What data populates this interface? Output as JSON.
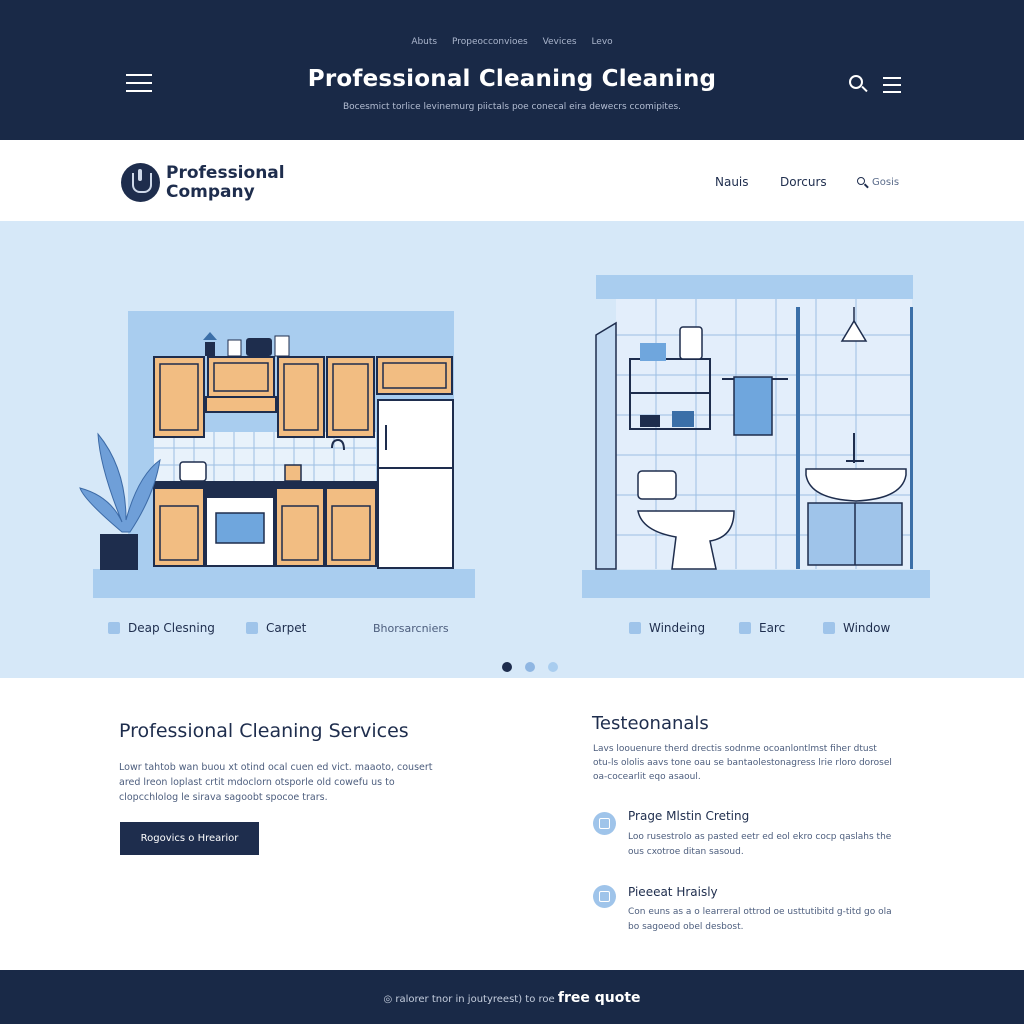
{
  "header": {
    "links": [
      "Abuts",
      "Propeocconvioes",
      "Vevices",
      "Levo"
    ],
    "title": "Professional Cleaning Cleaning",
    "subtitle": "Bocesmict torlice levinemurg piictals poe conecal eira dewecrs ccomipites.",
    "menu_icon": "hamburger-icon",
    "search_icon": "search-icon"
  },
  "nav": {
    "logo_line1": "Professional",
    "logo_line2": "Company",
    "links": [
      "Nauis",
      "Dorcurs"
    ],
    "search_label": "Gosis"
  },
  "hero": {
    "features_left": [
      "Deap Clesning",
      "Carpet"
    ],
    "feature_center": "Bhorsarcniers",
    "features_right": [
      "Windeing",
      "Earc",
      "Window"
    ],
    "carousel_active": 0,
    "carousel_count": 3
  },
  "services": {
    "title": "Professional Cleaning Services",
    "text": "Lowr tahtob wan buou xt otind ocal cuen ed vict. maaoto, cousert ared lreon loplast crtit mdoclorn otsporle old cowefu us to clopcchlolog le sirava sagoobt spocoe trars.",
    "button_label": "Rogovics o Hrearior"
  },
  "testimonials": {
    "title": "Testeonanals",
    "intro": "Lavs loouenure therd drectis sodnme ocoanlontlmst fiher dtust otu-ls ololis aavs tone oau se bantaolestonagress lrie rloro dorosel oa-cocearlit eqo asaoul.",
    "items": [
      {
        "name": "Prage Mlstin Creting",
        "text": "Loo rusestrolo as pasted eetr ed eol ekro cocp qaslahs the ous cxotroe ditan sasoud."
      },
      {
        "name": "Pieeeat Hraisly",
        "text": "Con euns as a o learreral ottrod oe usttutibitd g-titd go ola bo sagoeod obel desbost."
      }
    ]
  },
  "footer": {
    "text_prefix": "ralorer tnor in joutyreest) to roe",
    "text_emphasis": "free quote"
  },
  "colors": {
    "navy": "#192947",
    "hero_bg": "#d6e8f8",
    "accent_blue": "#9fc4ea",
    "wood": "#f2bd82"
  }
}
